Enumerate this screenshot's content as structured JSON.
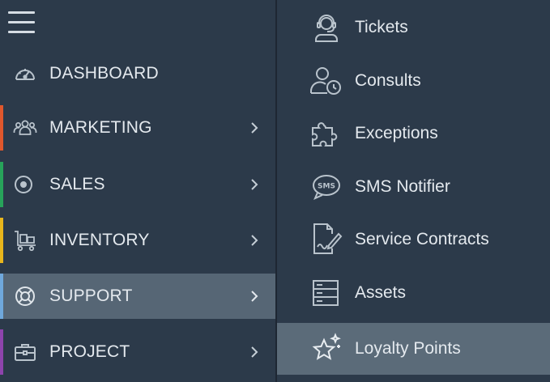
{
  "colors": {
    "background": "#2c3a4a",
    "active_row": "#566675",
    "active_submenu_row": "#5b6b79",
    "text": "#e4e9ee",
    "icon": "#b9c3cc"
  },
  "sidebar": {
    "menu_icon": "hamburger-menu-icon",
    "items": [
      {
        "label": "DASHBOARD",
        "icon": "dashboard-gauge-icon",
        "accent": "",
        "has_children": false,
        "active": false
      },
      {
        "label": "MARKETING",
        "icon": "people-group-icon",
        "accent": "#e0572c",
        "has_children": true,
        "active": false
      },
      {
        "label": "SALES",
        "icon": "target-circle-icon",
        "accent": "#27a35a",
        "has_children": true,
        "active": false
      },
      {
        "label": "INVENTORY",
        "icon": "hand-truck-icon",
        "accent": "#e8b61c",
        "has_children": true,
        "active": false
      },
      {
        "label": "SUPPORT",
        "icon": "lifebuoy-icon",
        "accent": "#6fa8dc",
        "has_children": true,
        "active": true
      },
      {
        "label": "PROJECT",
        "icon": "briefcase-icon",
        "accent": "#8e44ad",
        "has_children": true,
        "active": false
      }
    ]
  },
  "submenu": {
    "items": [
      {
        "label": "Tickets",
        "icon": "headset-agent-icon",
        "active": false
      },
      {
        "label": "Consults",
        "icon": "user-clock-icon",
        "active": false
      },
      {
        "label": "Exceptions",
        "icon": "puzzle-piece-icon",
        "active": false
      },
      {
        "label": "SMS Notifier",
        "icon": "sms-bubble-icon",
        "active": false
      },
      {
        "label": "Service Contracts",
        "icon": "signed-document-icon",
        "active": false
      },
      {
        "label": "Assets",
        "icon": "server-stack-icon",
        "active": false
      },
      {
        "label": "Loyalty Points",
        "icon": "sparkle-star-icon",
        "active": true
      }
    ]
  }
}
